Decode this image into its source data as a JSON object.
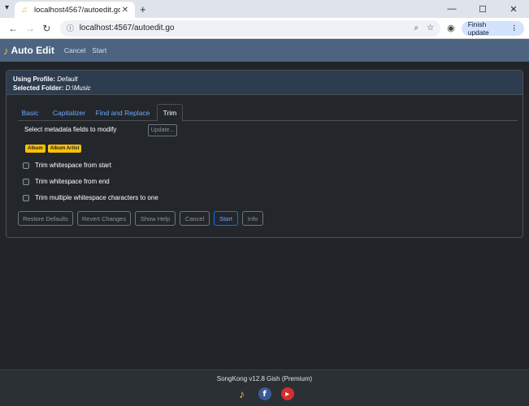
{
  "browser": {
    "tab_title": "localhost4567/autoedit.go",
    "url": "localhost:4567/autoedit.go",
    "finish_update": "Finish update"
  },
  "navbar": {
    "brand": "Auto Edit",
    "cancel": "Cancel",
    "start": "Start"
  },
  "header": {
    "profile_label": "Using Profile:",
    "profile_value": "Default",
    "folder_label": "Selected Folder:",
    "folder_value": "D:\\Music"
  },
  "tabs": [
    {
      "label": "Basic",
      "active": false
    },
    {
      "label": "Capitalizer",
      "active": false
    },
    {
      "label": "Find and Replace",
      "active": false
    },
    {
      "label": "Trim",
      "active": true
    }
  ],
  "trim": {
    "fields_label": "Select metadata fields to modify",
    "update_button": "Update...",
    "badges": [
      "Album",
      "Album Artist"
    ],
    "options": [
      {
        "label": "Trim whitespace from start",
        "checked": false
      },
      {
        "label": "Trim whitespace from end",
        "checked": false
      },
      {
        "label": "Trim multiple whitespace characters to one",
        "checked": false
      }
    ]
  },
  "buttons": {
    "restore_defaults": "Restore Defaults",
    "revert_changes": "Revert Changes",
    "show_help": "Show Help",
    "cancel": "Cancel",
    "start": "Start",
    "info": "Info"
  },
  "footer": {
    "version": "SongKong v12.8 Gish (Premium)"
  },
  "colors": {
    "navbar": "#4c6482",
    "badge": "#ffc107",
    "primary": "#0d6efd",
    "background": "#212529"
  }
}
